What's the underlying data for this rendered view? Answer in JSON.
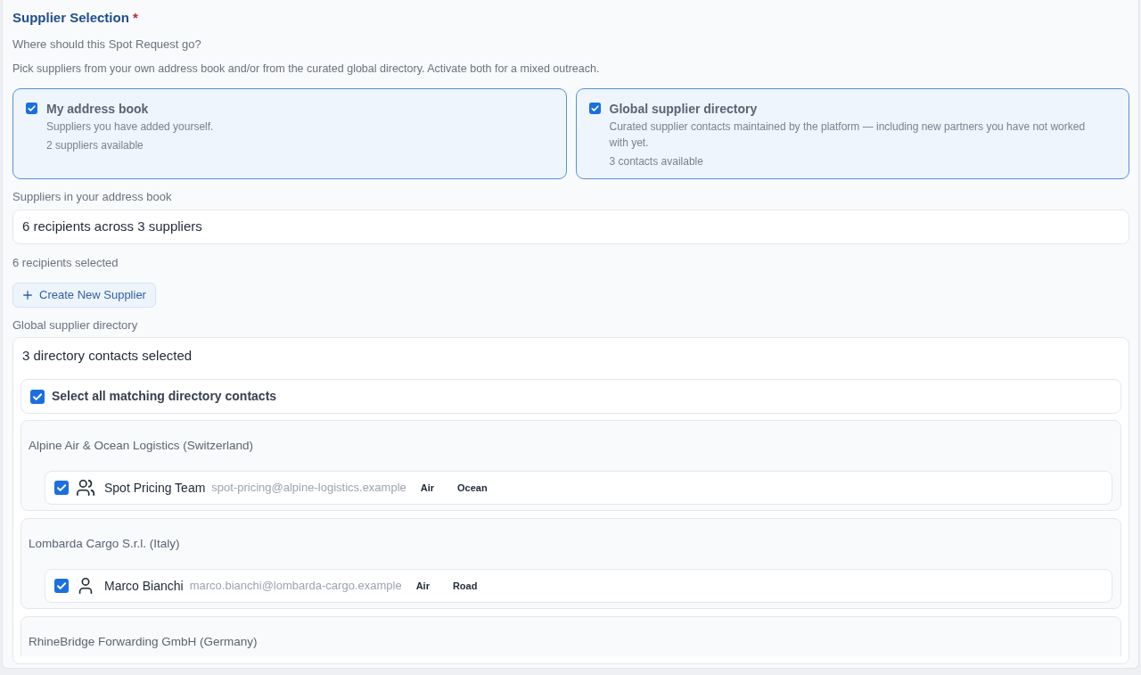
{
  "section": {
    "title": "Supplier Selection",
    "required_mark": "*",
    "question": "Where should this Spot Request go?",
    "hint": "Pick suppliers from your own address book and/or from the curated global directory. Activate both for a mixed outreach."
  },
  "sources": [
    {
      "title": "My address book",
      "description": "Suppliers you have added yourself.",
      "count": "2 suppliers available",
      "checked": true
    },
    {
      "title": "Global supplier directory",
      "description": "Curated supplier contacts maintained by the platform — including new partners you have not worked with yet.",
      "count": "3 contacts available",
      "checked": true
    }
  ],
  "address_book": {
    "label": "Suppliers in your address book",
    "value": "6 recipients across 3 suppliers",
    "selected_count": "6 recipients selected",
    "create_button": "Create New Supplier"
  },
  "directory": {
    "label": "Global supplier directory",
    "value": "3 directory contacts selected",
    "select_all": {
      "label": "Select all matching directory contacts",
      "checked": true
    },
    "groups": [
      {
        "name": "Alpine Air & Ocean Logistics (Switzerland)",
        "contacts": [
          {
            "kind": "team",
            "name": "Spot Pricing Team",
            "email": "spot-pricing@alpine-logistics.example",
            "checked": true,
            "tags": [
              "Air",
              "Ocean"
            ]
          }
        ]
      },
      {
        "name": "Lombarda Cargo S.r.l. (Italy)",
        "contacts": [
          {
            "kind": "person",
            "name": "Marco Bianchi",
            "email": "marco.bianchi@lombarda-cargo.example",
            "checked": true,
            "tags": [
              "Air",
              "Road"
            ]
          }
        ]
      },
      {
        "name": "RhineBridge Forwarding GmbH (Germany)"
      }
    ]
  }
}
